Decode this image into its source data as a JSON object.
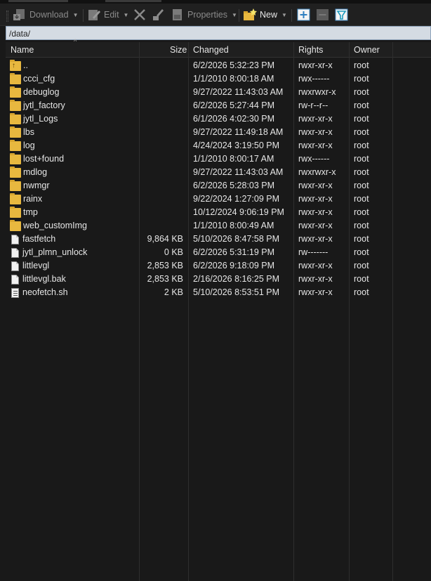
{
  "toolbar": {
    "download_label": "Download",
    "edit_label": "Edit",
    "properties_label": "Properties",
    "new_label": "New"
  },
  "path": "/data/",
  "columns": {
    "name": "Name",
    "size": "Size",
    "changed": "Changed",
    "rights": "Rights",
    "owner": "Owner"
  },
  "files": [
    {
      "name": "..",
      "size": "",
      "changed": "6/2/2026 5:32:23 PM",
      "rights": "rwxr-xr-x",
      "owner": "root",
      "type": "parent"
    },
    {
      "name": "ccci_cfg",
      "size": "",
      "changed": "1/1/2010 8:00:18 AM",
      "rights": "rwx------",
      "owner": "root",
      "type": "folder"
    },
    {
      "name": "debuglog",
      "size": "",
      "changed": "9/27/2022 11:43:03 AM",
      "rights": "rwxrwxr-x",
      "owner": "root",
      "type": "folder"
    },
    {
      "name": "jytl_factory",
      "size": "",
      "changed": "6/2/2026 5:27:44 PM",
      "rights": "rw-r--r--",
      "owner": "root",
      "type": "folder"
    },
    {
      "name": "jytl_Logs",
      "size": "",
      "changed": "6/1/2026 4:02:30 PM",
      "rights": "rwxr-xr-x",
      "owner": "root",
      "type": "folder"
    },
    {
      "name": "lbs",
      "size": "",
      "changed": "9/27/2022 11:49:18 AM",
      "rights": "rwxr-xr-x",
      "owner": "root",
      "type": "folder"
    },
    {
      "name": "log",
      "size": "",
      "changed": "4/24/2024 3:19:50 PM",
      "rights": "rwxr-xr-x",
      "owner": "root",
      "type": "folder"
    },
    {
      "name": "lost+found",
      "size": "",
      "changed": "1/1/2010 8:00:17 AM",
      "rights": "rwx------",
      "owner": "root",
      "type": "folder"
    },
    {
      "name": "mdlog",
      "size": "",
      "changed": "9/27/2022 11:43:03 AM",
      "rights": "rwxrwxr-x",
      "owner": "root",
      "type": "folder"
    },
    {
      "name": "nwmgr",
      "size": "",
      "changed": "6/2/2026 5:28:03 PM",
      "rights": "rwxr-xr-x",
      "owner": "root",
      "type": "folder"
    },
    {
      "name": "rainx",
      "size": "",
      "changed": "9/22/2024 1:27:09 PM",
      "rights": "rwxr-xr-x",
      "owner": "root",
      "type": "folder"
    },
    {
      "name": "tmp",
      "size": "",
      "changed": "10/12/2024 9:06:19 PM",
      "rights": "rwxr-xr-x",
      "owner": "root",
      "type": "folder"
    },
    {
      "name": "web_customImg",
      "size": "",
      "changed": "1/1/2010 8:00:49 AM",
      "rights": "rwxr-xr-x",
      "owner": "root",
      "type": "folder"
    },
    {
      "name": "fastfetch",
      "size": "9,864 KB",
      "changed": "5/10/2026 8:47:58 PM",
      "rights": "rwxr-xr-x",
      "owner": "root",
      "type": "file"
    },
    {
      "name": "jytl_plmn_unlock",
      "size": "0 KB",
      "changed": "6/2/2026 5:31:19 PM",
      "rights": "rw-------",
      "owner": "root",
      "type": "file"
    },
    {
      "name": "littlevgl",
      "size": "2,853 KB",
      "changed": "6/2/2026 9:18:09 PM",
      "rights": "rwxr-xr-x",
      "owner": "root",
      "type": "file"
    },
    {
      "name": "littlevgl.bak",
      "size": "2,853 KB",
      "changed": "2/16/2026 8:16:25 PM",
      "rights": "rwxr-xr-x",
      "owner": "root",
      "type": "file"
    },
    {
      "name": "neofetch.sh",
      "size": "2 KB",
      "changed": "5/10/2026 8:53:51 PM",
      "rights": "rwxr-xr-x",
      "owner": "root",
      "type": "script"
    }
  ]
}
